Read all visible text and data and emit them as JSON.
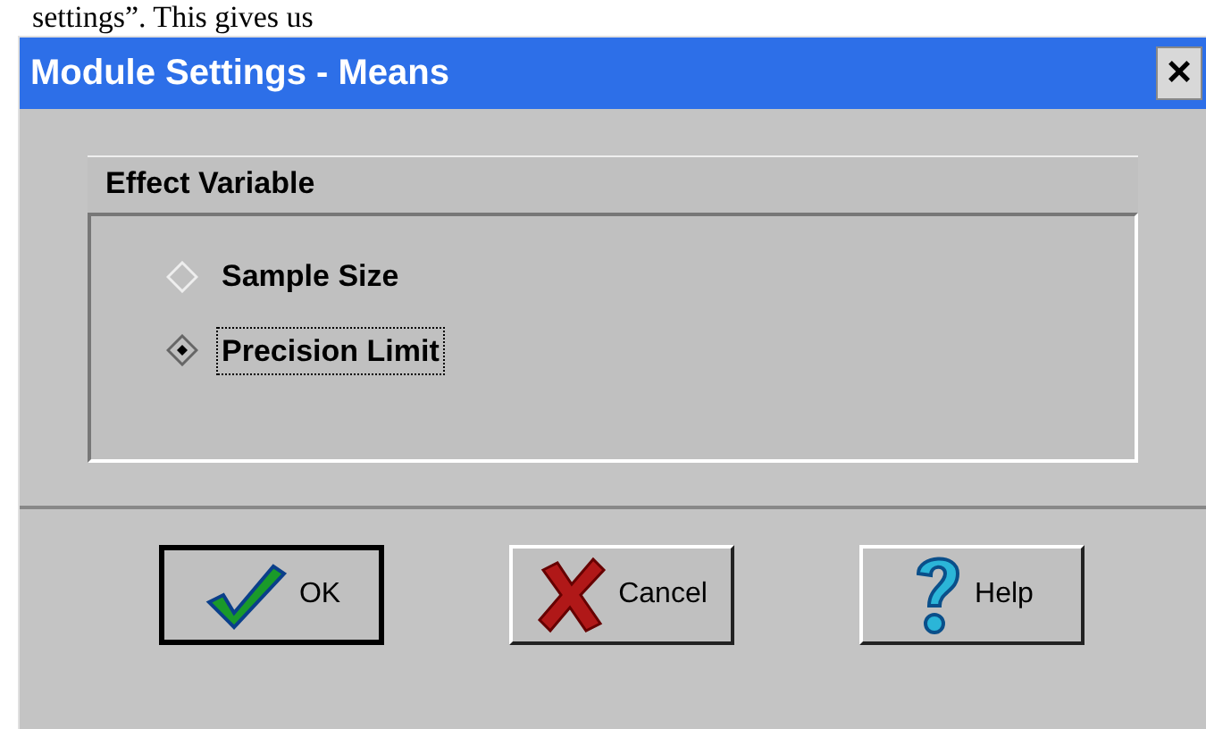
{
  "document_text": "settings”. This gives us",
  "window": {
    "title": "Module Settings - Means",
    "close": "×"
  },
  "group": {
    "title": "Effect Variable",
    "options": [
      {
        "label": "Sample Size",
        "selected": false
      },
      {
        "label": "Precision Limit",
        "selected": true
      }
    ]
  },
  "buttons": [
    {
      "kind": "ok",
      "label": "OK",
      "default": true
    },
    {
      "kind": "cancel",
      "label": "Cancel",
      "default": false
    },
    {
      "kind": "help",
      "label": "Help",
      "default": false
    }
  ]
}
